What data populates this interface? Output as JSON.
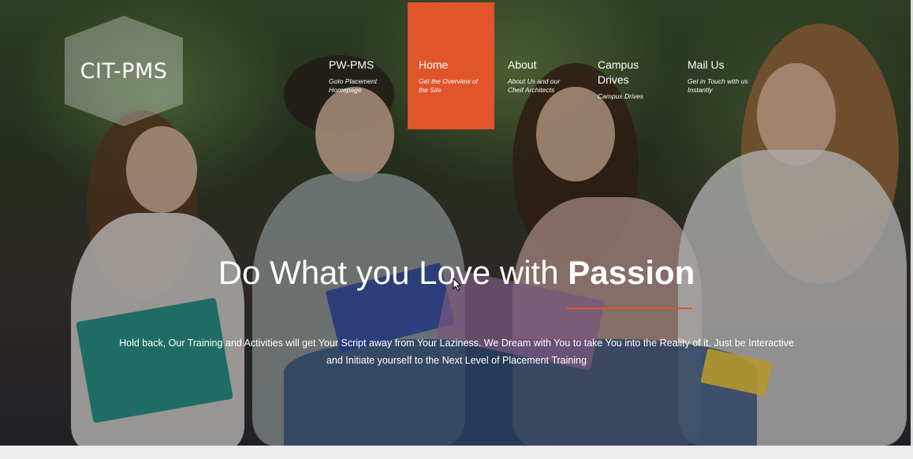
{
  "logo": {
    "text": "CIT-PMS"
  },
  "nav": {
    "items": [
      {
        "title": "PW-PMS",
        "subtitle": "Goto Placement Homepage"
      },
      {
        "title": "Home",
        "subtitle": "Get the Overview of the Site"
      },
      {
        "title": "About",
        "subtitle": "About Us and our Cheif Architects"
      },
      {
        "title": "Campus Drives",
        "subtitle": "Campus Drives"
      },
      {
        "title": "Mail Us",
        "subtitle": "Get in Touch with us Instantly"
      }
    ],
    "active_index": 1
  },
  "hero": {
    "headline_light": "Do What you Love with",
    "headline_bold": "Passion",
    "tagline": "Hold back, Our Training and Activities will get Your Script away from Your Laziness. We Dream with You to take You into the Reality of it. Just be Interactive and Initiate yourself to the Next Level of Placement Training"
  },
  "colors": {
    "accent": "#e0552a",
    "logo_overlay": "rgba(255,255,255,0.30)",
    "text": "#ffffff"
  }
}
